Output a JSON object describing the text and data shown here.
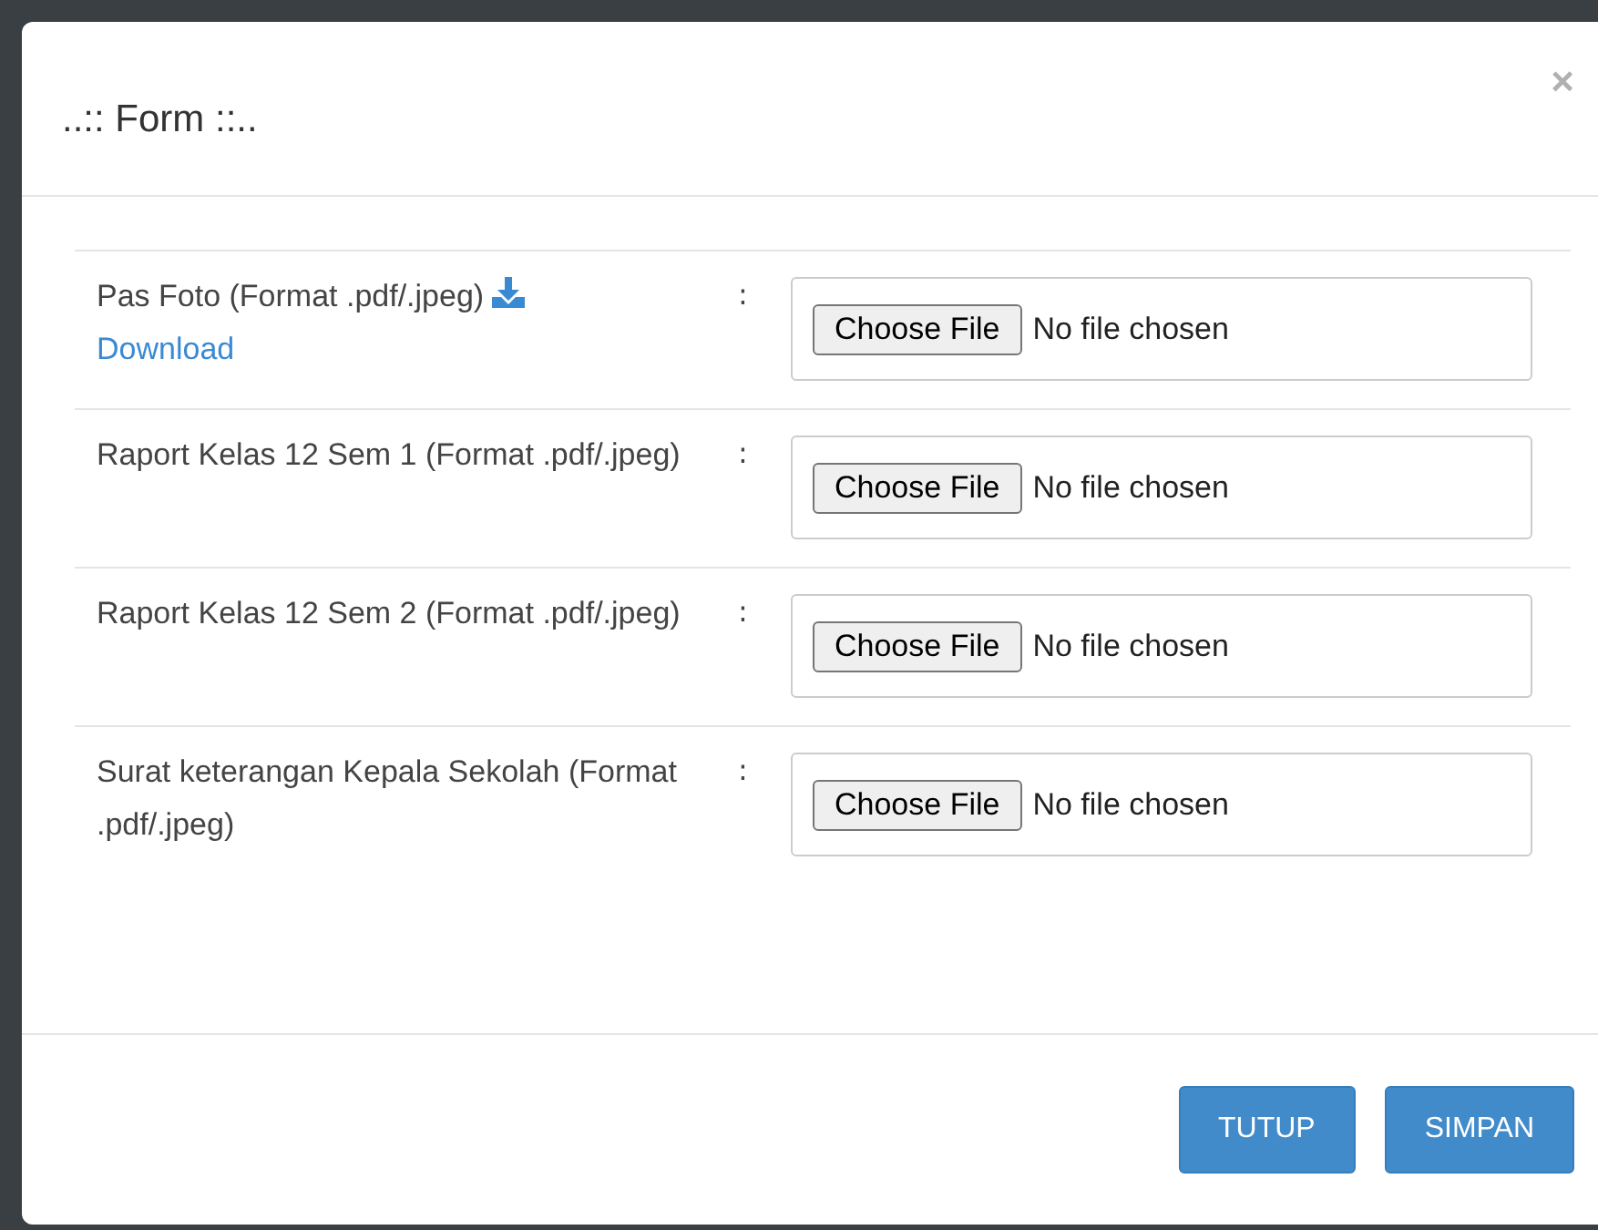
{
  "modal": {
    "title": "..:: Form ::..",
    "close": "×"
  },
  "fields": [
    {
      "label": "Pas Foto (Format .pdf/.jpeg)",
      "link": "Download",
      "separator": ":",
      "button": "Choose File",
      "status": "No file chosen"
    },
    {
      "label": "Raport Kelas 12 Sem 1 (Format .pdf/.jpeg)",
      "separator": ":",
      "button": "Choose File",
      "status": "No file chosen"
    },
    {
      "label": "Raport Kelas 12 Sem 2 (Format .pdf/.jpeg)",
      "separator": ":",
      "button": "Choose File",
      "status": "No file chosen"
    },
    {
      "label": "Surat keterangan Kepala Sekolah (Format .pdf/.jpeg)",
      "separator": ":",
      "button": "Choose File",
      "status": "No file chosen"
    }
  ],
  "buttons": [
    "TUTUP",
    "SIMPAN"
  ]
}
